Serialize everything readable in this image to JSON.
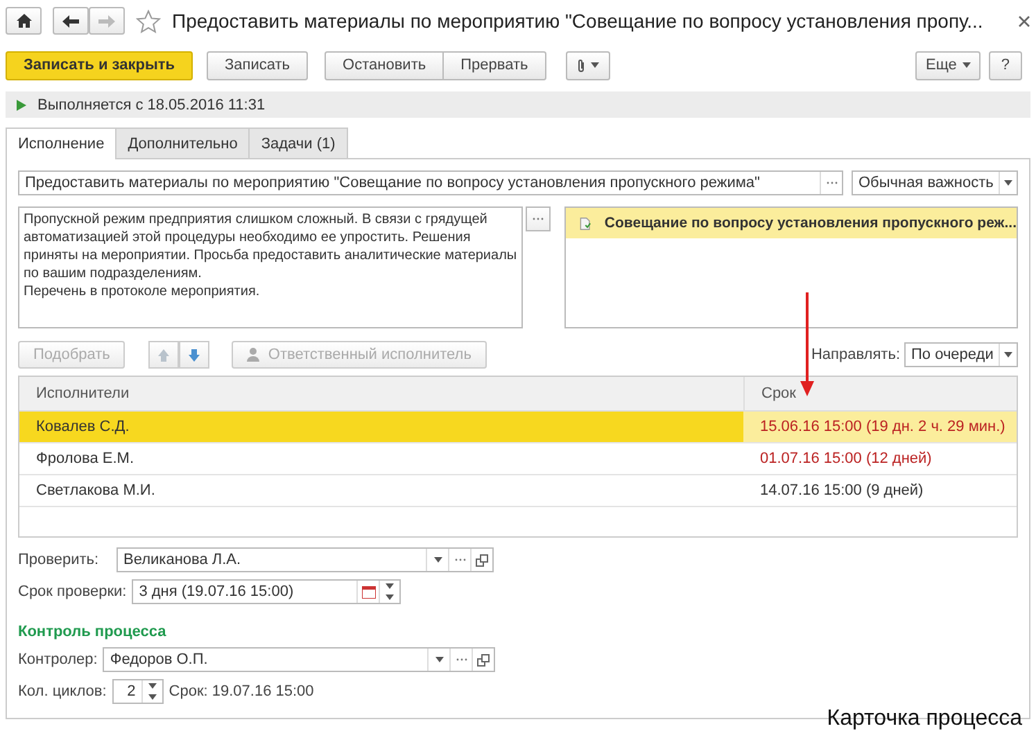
{
  "window": {
    "title": "Предоставить материалы по мероприятию \"Совещание по вопросу установления пропу..."
  },
  "toolbar": {
    "buttons": [
      {
        "kind": "primary",
        "label": "Записать и закрыть"
      },
      {
        "kind": "plain",
        "label": "Записать"
      },
      {
        "kind": "group-start",
        "label": "Остановить"
      },
      {
        "kind": "group-end",
        "label": "Прервать"
      },
      {
        "kind": "attach"
      }
    ],
    "more": "Еще",
    "help": "?"
  },
  "status": {
    "text": "Выполняется с 18.05.2016 11:31"
  },
  "tabs": [
    {
      "label": "Исполнение",
      "selected": true
    },
    {
      "label": "Дополнительно",
      "selected": false
    },
    {
      "label": "Задачи (1)",
      "selected": false
    }
  ],
  "subject": {
    "value": "Предоставить материалы по мероприятию \"Совещание по вопросу установления пропускного режима\"",
    "importance": "Обычная важность"
  },
  "description": "Пропускной режим предприятия слишком сложный. В связи с грядущей\nавтоматизацией этой процедуры необходимо ее упростить. Решения\nприняты на мероприятии. Просьба предоставить аналитические материалы\nпо вашим подразделениям.\nПеречень в протоколе мероприятия.",
  "attachments": [
    {
      "label": "Совещание по вопросу установления пропускного реж...",
      "selected": true
    }
  ],
  "pick_button": {
    "label": "Подобрать",
    "disabled": true
  },
  "move_up": {
    "disabled": true
  },
  "move_down": {
    "disabled": false
  },
  "responsible_button": {
    "label": "Ответственный исполнитель",
    "disabled": true
  },
  "route": {
    "label": "Направлять:",
    "value": "По очереди"
  },
  "table": {
    "columns": [
      "Исполнители",
      "Срок"
    ],
    "rows": [
      {
        "name": "Ковалев С.Д.",
        "due": "15.06.16 15:00 (19 дн. 2 ч. 29 мин.)",
        "selected": true,
        "warning": true
      },
      {
        "name": "Фролова Е.М.",
        "due": "01.07.16 15:00 (12 дней)",
        "selected": false,
        "warning": true
      },
      {
        "name": "Светлакова М.И.",
        "due": "14.07.16 15:00 (9 дней)",
        "selected": false,
        "warning": false
      }
    ]
  },
  "check": {
    "label": "Проверить:",
    "value": "Великанова Л.А."
  },
  "check_term": {
    "label": "Срок проверки:",
    "value": "3 дня (19.07.16 15:00)"
  },
  "control": {
    "heading": "Контроль процесса",
    "controller_label": "Контролер:",
    "controller": "Федоров О.П.",
    "cycles_label": "Кол. циклов:",
    "cycles": "2",
    "term": "Срок: 19.07.16 15:00"
  },
  "caption": "Карточка процесса"
}
